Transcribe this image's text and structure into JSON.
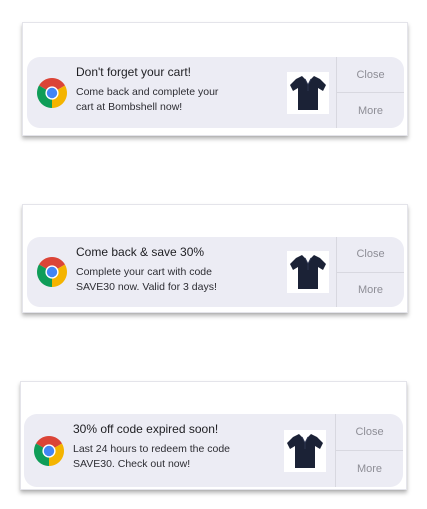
{
  "notifications": [
    {
      "app_icon": "chrome-icon",
      "title": "Don't forget your cart!",
      "body_line1": "Come back and complete your",
      "body_line2": "cart at Bombshell now!",
      "image": "navy-polo-shirt-icon",
      "close_label": "Close",
      "more_label": "More"
    },
    {
      "app_icon": "chrome-icon",
      "title": "Come back & save 30%",
      "body_line1": "Complete your cart with code",
      "body_line2": "SAVE30 now. Valid for 3 days!",
      "image": "navy-polo-shirt-icon",
      "close_label": "Close",
      "more_label": "More"
    },
    {
      "app_icon": "chrome-icon",
      "title": "30% off code expired soon!",
      "body_line1": "Last 24 hours to redeem the code",
      "body_line2": "SAVE30. Check out now!",
      "image": "navy-polo-shirt-icon",
      "close_label": "Close",
      "more_label": "More"
    }
  ],
  "colors": {
    "notification_bg": "#ececf4",
    "shirt": "#1b2236",
    "action_text": "#8e8e96",
    "chrome_red": "#db4437",
    "chrome_green": "#0f9d58",
    "chrome_yellow": "#f4b400",
    "chrome_blue": "#4285f4"
  }
}
